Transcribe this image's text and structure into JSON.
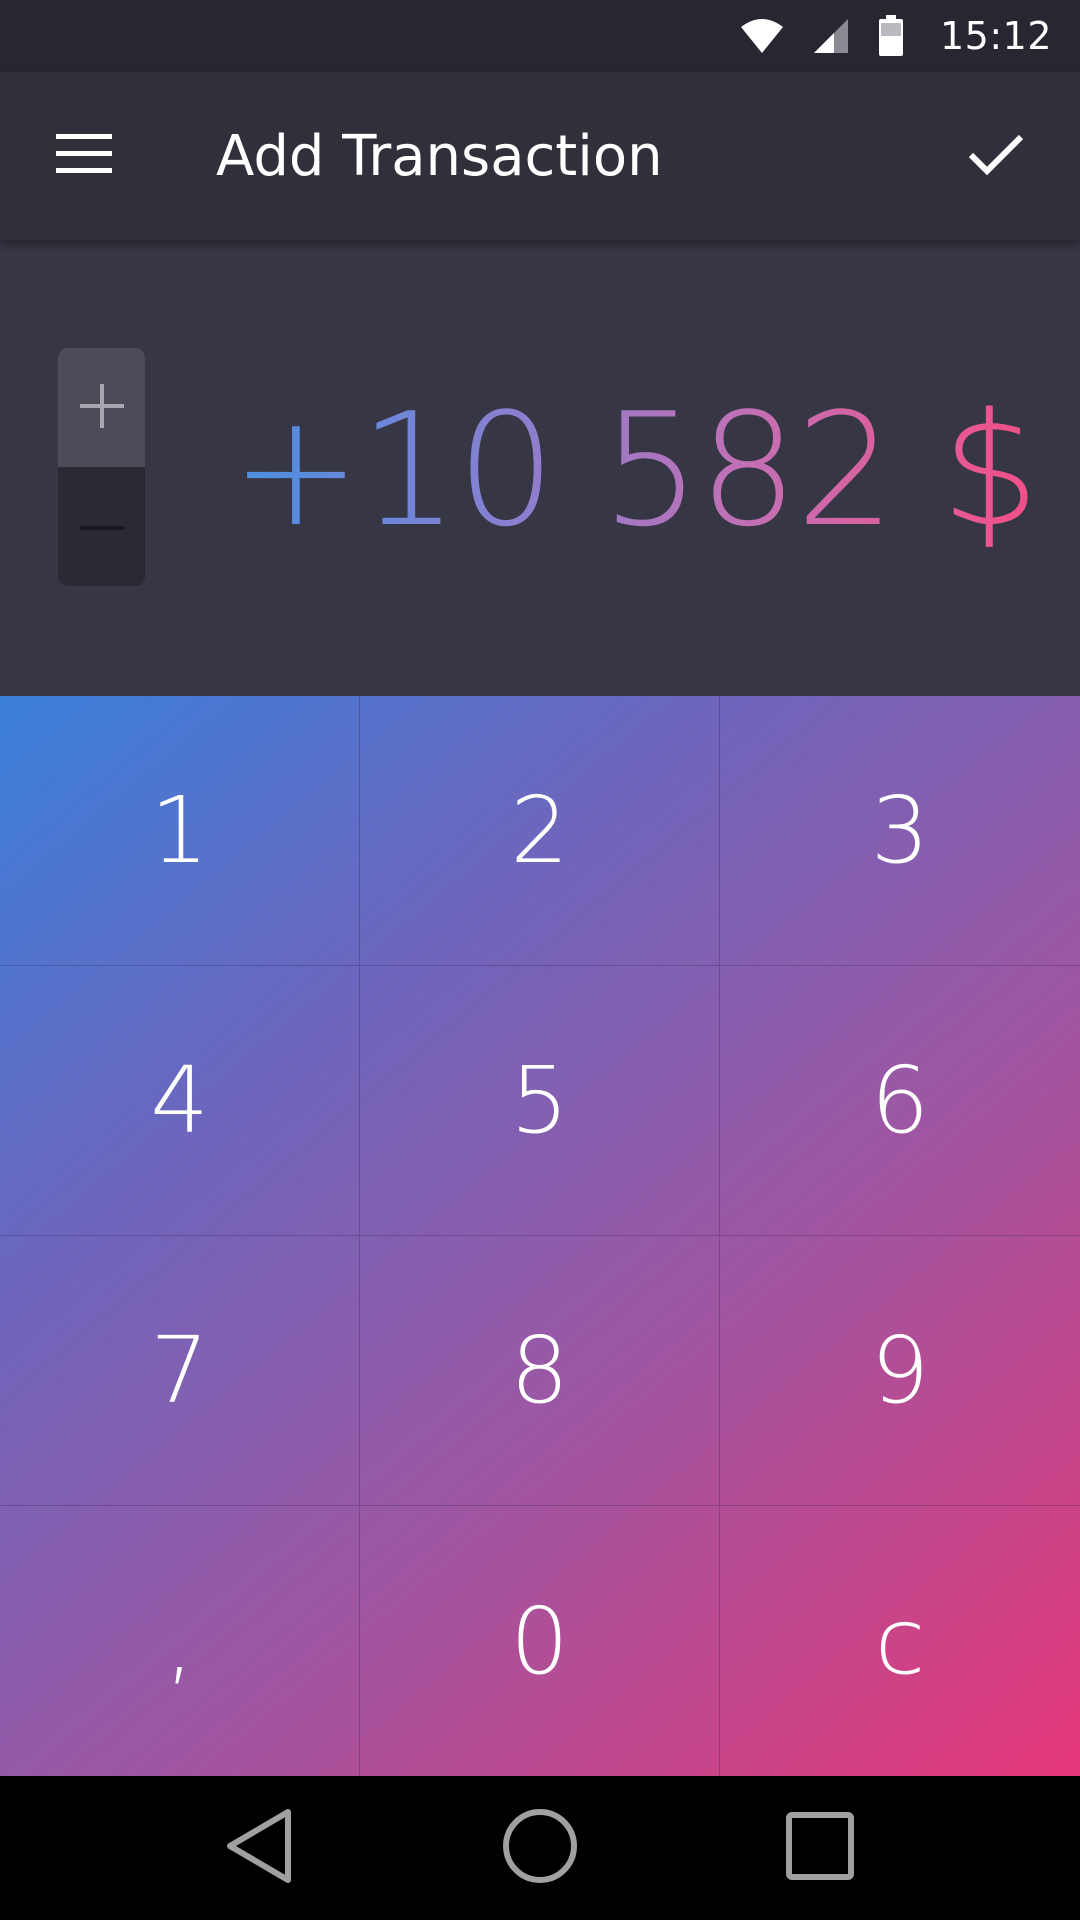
{
  "status_bar": {
    "time": "15:12",
    "icons": [
      "wifi-icon",
      "cell-signal-icon",
      "battery-icon"
    ]
  },
  "app_bar": {
    "title": "Add Transaction",
    "menu_icon": "hamburger-menu-icon",
    "confirm_icon": "checkmark-icon"
  },
  "amount": {
    "display": "+10 582 $",
    "sign_plus_icon": "plus-icon",
    "sign_minus_icon": "minus-icon",
    "selected_sign": "+"
  },
  "keypad": {
    "keys": [
      "1",
      "2",
      "3",
      "4",
      "5",
      "6",
      "7",
      "8",
      "9",
      ",",
      "0",
      "c"
    ]
  },
  "nav_bar": {
    "icons": [
      "back-triangle-icon",
      "home-circle-icon",
      "recents-square-icon"
    ]
  },
  "colors": {
    "status_bar_bg": "#272731",
    "app_bar_bg": "#30303b",
    "amount_panel_bg": "#363644",
    "keypad_gradient_start": "#3a80db",
    "keypad_gradient_end": "#e6387a",
    "amount_gradient_start": "#4a90e2",
    "amount_gradient_end": "#f44f86"
  }
}
